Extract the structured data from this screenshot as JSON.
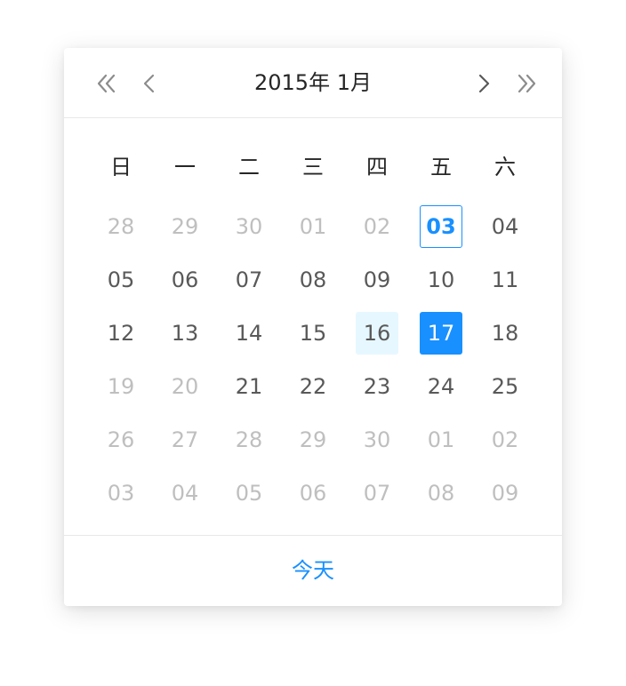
{
  "header": {
    "year_label": "2015年",
    "month_label": "1月"
  },
  "weekdays": [
    "日",
    "一",
    "二",
    "三",
    "四",
    "五",
    "六"
  ],
  "weeks": [
    [
      {
        "label": "28",
        "state": "muted"
      },
      {
        "label": "29",
        "state": "muted"
      },
      {
        "label": "30",
        "state": "muted"
      },
      {
        "label": "01",
        "state": "muted"
      },
      {
        "label": "02",
        "state": "muted"
      },
      {
        "label": "03",
        "state": "today"
      },
      {
        "label": "04",
        "state": "normal"
      }
    ],
    [
      {
        "label": "05",
        "state": "normal"
      },
      {
        "label": "06",
        "state": "normal"
      },
      {
        "label": "07",
        "state": "normal"
      },
      {
        "label": "08",
        "state": "normal"
      },
      {
        "label": "09",
        "state": "normal"
      },
      {
        "label": "10",
        "state": "normal"
      },
      {
        "label": "11",
        "state": "normal"
      }
    ],
    [
      {
        "label": "12",
        "state": "normal"
      },
      {
        "label": "13",
        "state": "normal"
      },
      {
        "label": "14",
        "state": "normal"
      },
      {
        "label": "15",
        "state": "normal"
      },
      {
        "label": "16",
        "state": "hover"
      },
      {
        "label": "17",
        "state": "selected"
      },
      {
        "label": "18",
        "state": "normal"
      }
    ],
    [
      {
        "label": "19",
        "state": "muted"
      },
      {
        "label": "20",
        "state": "muted"
      },
      {
        "label": "21",
        "state": "normal"
      },
      {
        "label": "22",
        "state": "normal"
      },
      {
        "label": "23",
        "state": "normal"
      },
      {
        "label": "24",
        "state": "normal"
      },
      {
        "label": "25",
        "state": "normal"
      }
    ],
    [
      {
        "label": "26",
        "state": "muted"
      },
      {
        "label": "27",
        "state": "muted"
      },
      {
        "label": "28",
        "state": "muted"
      },
      {
        "label": "29",
        "state": "muted"
      },
      {
        "label": "30",
        "state": "muted"
      },
      {
        "label": "01",
        "state": "muted"
      },
      {
        "label": "02",
        "state": "muted"
      }
    ],
    [
      {
        "label": "03",
        "state": "muted"
      },
      {
        "label": "04",
        "state": "muted"
      },
      {
        "label": "05",
        "state": "muted"
      },
      {
        "label": "06",
        "state": "muted"
      },
      {
        "label": "07",
        "state": "muted"
      },
      {
        "label": "08",
        "state": "muted"
      },
      {
        "label": "09",
        "state": "muted"
      }
    ]
  ],
  "footer": {
    "today_label": "今天"
  },
  "icons": {
    "super_prev": "double-chevron-left-icon",
    "prev": "chevron-left-icon",
    "next": "chevron-right-icon",
    "super_next": "double-chevron-right-icon"
  },
  "colors": {
    "accent": "#1890ff",
    "hover_bg": "#e6f7ff",
    "text": "#595959",
    "muted": "#bfbfbf",
    "heading": "#262626"
  }
}
